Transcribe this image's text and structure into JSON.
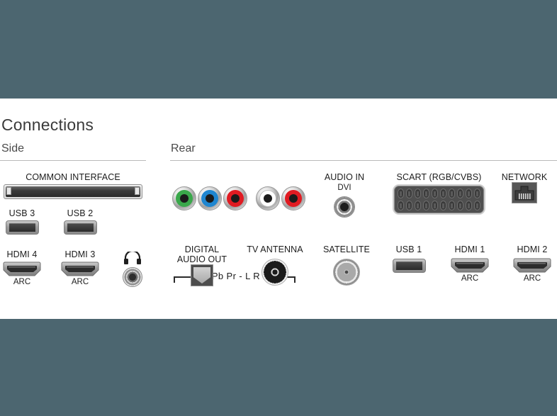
{
  "page": {
    "title": "Connections",
    "background_color": "#4c6670",
    "panel_color": "#ffffff"
  },
  "sections": {
    "side": {
      "label": "Side"
    },
    "rear": {
      "label": "Rear"
    }
  },
  "side_ports": {
    "common_interface": {
      "label": "COMMON INTERFACE",
      "icon": "ci-slot-icon"
    },
    "usb3": {
      "label": "USB 3",
      "icon": "usb-port-icon"
    },
    "usb2": {
      "label": "USB 2",
      "icon": "usb-port-icon"
    },
    "hdmi4": {
      "label": "HDMI 4",
      "sub": "ARC",
      "icon": "hdmi-port-icon"
    },
    "hdmi3": {
      "label": "HDMI 3",
      "sub": "ARC",
      "icon": "hdmi-port-icon"
    },
    "headphone": {
      "label": "",
      "icon": "headphone-icon"
    }
  },
  "rear_ports": {
    "component": {
      "label": "Y Pb Pr - L R",
      "jacks": [
        {
          "name": "Y",
          "color": "#3aa84b",
          "icon": "rca-jack-green-icon"
        },
        {
          "name": "Pb",
          "color": "#1f86d0",
          "icon": "rca-jack-blue-icon"
        },
        {
          "name": "Pr",
          "color": "#e01b22",
          "icon": "rca-jack-red-icon"
        },
        {
          "name": "L",
          "color": "#ffffff",
          "icon": "rca-jack-white-icon"
        },
        {
          "name": "R",
          "color": "#e01b22",
          "icon": "rca-jack-red-icon"
        }
      ]
    },
    "audio_in": {
      "label": "AUDIO IN",
      "sub": "DVI",
      "icon": "mini-jack-icon"
    },
    "scart": {
      "label": "SCART (RGB/CVBS)",
      "icon": "scart-connector-icon",
      "pins_per_row": 10
    },
    "network": {
      "label": "NETWORK",
      "icon": "rj45-network-icon"
    },
    "digital_audio_out": {
      "label_line1": "DIGITAL",
      "label_line2": "AUDIO OUT",
      "icon": "optical-toslink-icon"
    },
    "tv_antenna": {
      "label": "TV ANTENNA",
      "icon": "coax-antenna-icon"
    },
    "satellite": {
      "label": "SATELLITE",
      "icon": "coax-satellite-icon"
    },
    "usb1": {
      "label": "USB 1",
      "icon": "usb-port-icon"
    },
    "hdmi1": {
      "label": "HDMI 1",
      "sub": "ARC",
      "icon": "hdmi-port-icon"
    },
    "hdmi2": {
      "label": "HDMI 2",
      "sub": "ARC",
      "icon": "hdmi-port-icon"
    }
  }
}
